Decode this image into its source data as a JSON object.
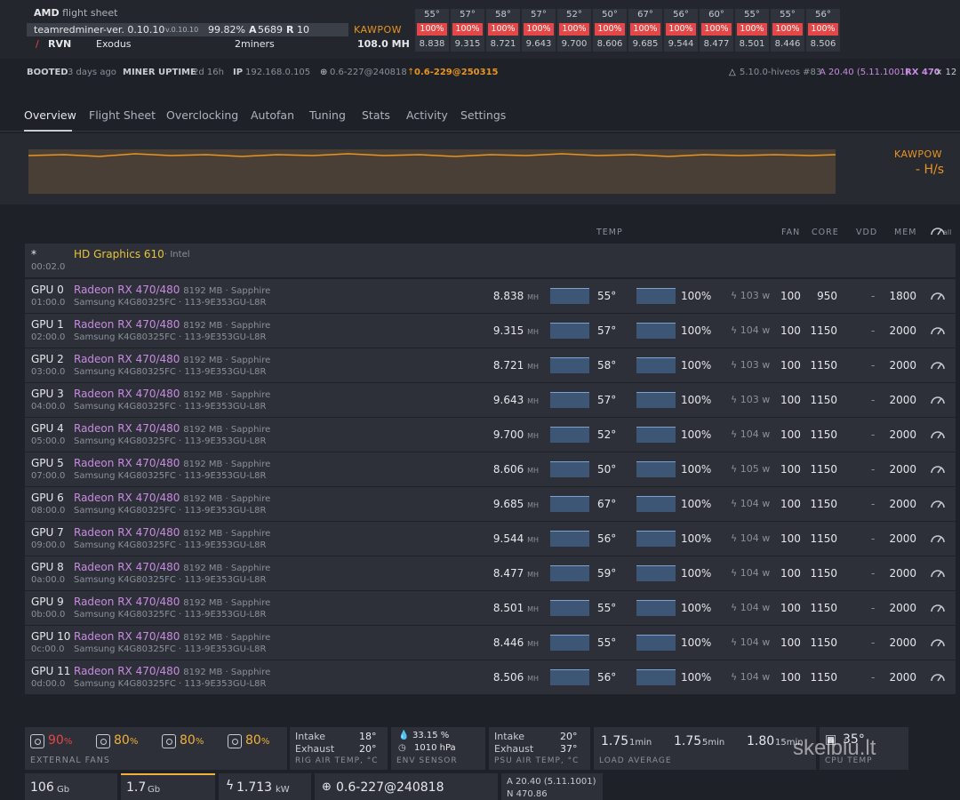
{
  "header": {
    "flight_sheet_brand": "AMD",
    "flight_sheet_label": "flight sheet",
    "miner": "teamredminer-ver. 0.10.10",
    "miner_version": "v.0.10.10",
    "share_rate": "99.82%",
    "accepted_label": "A",
    "accepted": "5689",
    "rejected_label": "R",
    "rejected": "10",
    "coin": "RVN",
    "wallet": "Exodus",
    "pool": "2miners",
    "algo": "KAWPOW",
    "total_hashrate": "108.0 MH"
  },
  "gpu_summary": [
    {
      "temp": "55°",
      "fan": "100%",
      "hash": "8.838"
    },
    {
      "temp": "57°",
      "fan": "100%",
      "hash": "9.315"
    },
    {
      "temp": "58°",
      "fan": "100%",
      "hash": "8.721"
    },
    {
      "temp": "57°",
      "fan": "100%",
      "hash": "9.643"
    },
    {
      "temp": "52°",
      "fan": "100%",
      "hash": "9.700"
    },
    {
      "temp": "50°",
      "fan": "100%",
      "hash": "8.606"
    },
    {
      "temp": "67°",
      "fan": "100%",
      "hash": "9.685"
    },
    {
      "temp": "56°",
      "fan": "100%",
      "hash": "9.544"
    },
    {
      "temp": "60°",
      "fan": "100%",
      "hash": "8.477"
    },
    {
      "temp": "55°",
      "fan": "100%",
      "hash": "8.501"
    },
    {
      "temp": "55°",
      "fan": "100%",
      "hash": "8.446"
    },
    {
      "temp": "56°",
      "fan": "100%",
      "hash": "8.506"
    }
  ],
  "info": {
    "booted_label": "BOOTED",
    "booted": "3 days ago",
    "uptime_label": "MINER UPTIME",
    "uptime": "2d 16h",
    "ip_label": "IP",
    "ip": "192.168.0.105",
    "hive_version": "0.6-227@240818",
    "hive_update": "0.6-229@250315",
    "kernel": "5.10.0-hiveos #83",
    "driver": "A 20.40 (5.11.1001)",
    "gpu_model": "RX 470",
    "gpu_count": "× 12"
  },
  "tabs": [
    "Overview",
    "Flight Sheet",
    "Overclocking",
    "Autofan",
    "Tuning",
    "Stats",
    "Activity",
    "Settings"
  ],
  "chart": {
    "algo": "KAWPOW",
    "rate": "- H/s"
  },
  "columns": {
    "temp": "TEMP",
    "fan": "FAN",
    "core": "CORE",
    "vdd": "VDD",
    "mem": "MEM",
    "all": "all"
  },
  "igpu": {
    "id": "*",
    "bus": "00:02.0",
    "name": "HD Graphics 610",
    "vendor": "· Intel"
  },
  "gpus": [
    {
      "id": "GPU 0",
      "bus": "01:00.0",
      "model": "Radeon RX 470/480",
      "mem": "8192 MB · Sapphire",
      "vram": "Samsung K4G80325FC · 113-9E353GU-L8R",
      "hash": "8.838",
      "unit": "MH",
      "temp": "55°",
      "fan_pct": "100%",
      "power": "103 w",
      "fan": "100",
      "core": "950",
      "vdd": "-",
      "memclk": "1800"
    },
    {
      "id": "GPU 1",
      "bus": "02:00.0",
      "model": "Radeon RX 470/480",
      "mem": "8192 MB · Sapphire",
      "vram": "Samsung K4G80325FC · 113-9E353GU-L8R",
      "hash": "9.315",
      "unit": "MH",
      "temp": "57°",
      "fan_pct": "100%",
      "power": "104 w",
      "fan": "100",
      "core": "1150",
      "vdd": "-",
      "memclk": "2000"
    },
    {
      "id": "GPU 2",
      "bus": "03:00.0",
      "model": "Radeon RX 470/480",
      "mem": "8192 MB · Sapphire",
      "vram": "Samsung K4G80325FC · 113-9E353GU-L8R",
      "hash": "8.721",
      "unit": "MH",
      "temp": "58°",
      "fan_pct": "100%",
      "power": "103 w",
      "fan": "100",
      "core": "1150",
      "vdd": "-",
      "memclk": "2000"
    },
    {
      "id": "GPU 3",
      "bus": "04:00.0",
      "model": "Radeon RX 470/480",
      "mem": "8192 MB · Sapphire",
      "vram": "Samsung K4G80325FC · 113-9E353GU-L8R",
      "hash": "9.643",
      "unit": "MH",
      "temp": "57°",
      "fan_pct": "100%",
      "power": "103 w",
      "fan": "100",
      "core": "1150",
      "vdd": "-",
      "memclk": "2000"
    },
    {
      "id": "GPU 4",
      "bus": "05:00.0",
      "model": "Radeon RX 470/480",
      "mem": "8192 MB · Sapphire",
      "vram": "Samsung K4G80325FC · 113-9E353GU-L8R",
      "hash": "9.700",
      "unit": "MH",
      "temp": "52°",
      "fan_pct": "100%",
      "power": "104 w",
      "fan": "100",
      "core": "1150",
      "vdd": "-",
      "memclk": "2000"
    },
    {
      "id": "GPU 5",
      "bus": "07:00.0",
      "model": "Radeon RX 470/480",
      "mem": "8192 MB · Sapphire",
      "vram": "Samsung K4G80325FC · 113-9E353GU-L8R",
      "hash": "8.606",
      "unit": "MH",
      "temp": "50°",
      "fan_pct": "100%",
      "power": "105 w",
      "fan": "100",
      "core": "1150",
      "vdd": "-",
      "memclk": "2000"
    },
    {
      "id": "GPU 6",
      "bus": "08:00.0",
      "model": "Radeon RX 470/480",
      "mem": "8192 MB · Sapphire",
      "vram": "Samsung K4G80325FC · 113-9E353GU-L8R",
      "hash": "9.685",
      "unit": "MH",
      "temp": "67°",
      "fan_pct": "100%",
      "power": "104 w",
      "fan": "100",
      "core": "1150",
      "vdd": "-",
      "memclk": "2000"
    },
    {
      "id": "GPU 7",
      "bus": "09:00.0",
      "model": "Radeon RX 470/480",
      "mem": "8192 MB · Sapphire",
      "vram": "Samsung K4G80325FC · 113-9E353GU-L8R",
      "hash": "9.544",
      "unit": "MH",
      "temp": "56°",
      "fan_pct": "100%",
      "power": "104 w",
      "fan": "100",
      "core": "1150",
      "vdd": "-",
      "memclk": "2000"
    },
    {
      "id": "GPU 8",
      "bus": "0a:00.0",
      "model": "Radeon RX 470/480",
      "mem": "8192 MB · Sapphire",
      "vram": "Samsung K4G80325FC · 113-9E353GU-L8R",
      "hash": "8.477",
      "unit": "MH",
      "temp": "59°",
      "fan_pct": "100%",
      "power": "104 w",
      "fan": "100",
      "core": "1150",
      "vdd": "-",
      "memclk": "2000"
    },
    {
      "id": "GPU 9",
      "bus": "0b:00.0",
      "model": "Radeon RX 470/480",
      "mem": "8192 MB · Sapphire",
      "vram": "Samsung K4G80325FC · 113-9E353GU-L8R",
      "hash": "8.501",
      "unit": "MH",
      "temp": "55°",
      "fan_pct": "100%",
      "power": "104 w",
      "fan": "100",
      "core": "1150",
      "vdd": "-",
      "memclk": "2000"
    },
    {
      "id": "GPU 10",
      "bus": "0c:00.0",
      "model": "Radeon RX 470/480",
      "mem": "8192 MB · Sapphire",
      "vram": "Samsung K4G80325FC · 113-9E353GU-L8R",
      "hash": "8.446",
      "unit": "MH",
      "temp": "55°",
      "fan_pct": "100%",
      "power": "104 w",
      "fan": "100",
      "core": "1150",
      "vdd": "-",
      "memclk": "2000"
    },
    {
      "id": "GPU 11",
      "bus": "0d:00.0",
      "model": "Radeon RX 470/480",
      "mem": "8192 MB · Sapphire",
      "vram": "Samsung K4G80325FC · 113-9E353GU-L8R",
      "hash": "8.506",
      "unit": "MH",
      "temp": "56°",
      "fan_pct": "100%",
      "power": "104 w",
      "fan": "100",
      "core": "1150",
      "vdd": "-",
      "memclk": "2000"
    }
  ],
  "bottom": {
    "fans": [
      {
        "value": "90",
        "unit": "%",
        "color": "#e74646"
      },
      {
        "value": "80",
        "unit": "%",
        "color": "#f0b03a"
      },
      {
        "value": "80",
        "unit": "%",
        "color": "#f0b03a"
      },
      {
        "value": "80",
        "unit": "%",
        "color": "#f0b03a"
      }
    ],
    "fans_label": "EXTERNAL FANS",
    "rig_intake_label": "Intake",
    "rig_intake": "18°",
    "rig_exhaust_label": "Exhaust",
    "rig_exhaust": "20°",
    "rig_label": "RIG AIR TEMP, °C",
    "env_humidity": "33.15 %",
    "env_pressure": "1010 hPa",
    "env_label": "ENV SENSOR",
    "psu_intake_label": "Intake",
    "psu_intake": "20°",
    "psu_exhaust_label": "Exhaust",
    "psu_exhaust": "37°",
    "psu_label": "PSU AIR TEMP, °C",
    "la1": "1.75",
    "la1_unit": "1min",
    "la5": "1.75",
    "la5_unit": "5min",
    "la15": "1.80",
    "la15_unit": "15min",
    "la_label": "LOAD AVERAGE",
    "cpu_temp": "35°",
    "cpu_label": "CPU TEMP",
    "disk": "106",
    "disk_unit": "Gb",
    "ram": "1.7",
    "ram_unit": "Gb",
    "power": "1.713",
    "power_unit": "kW",
    "version": "0.6-227@240818",
    "drv_a": "A 20.40 (5.11.1001)",
    "drv_n": "N 470.86"
  },
  "watermark": "skelbiu.lt",
  "colors": {
    "accent_orange": "#e8941f",
    "gpu_model_purple": "#c88be0",
    "fan_red": "#e74646",
    "igpu_yellow": "#e8c33a"
  }
}
